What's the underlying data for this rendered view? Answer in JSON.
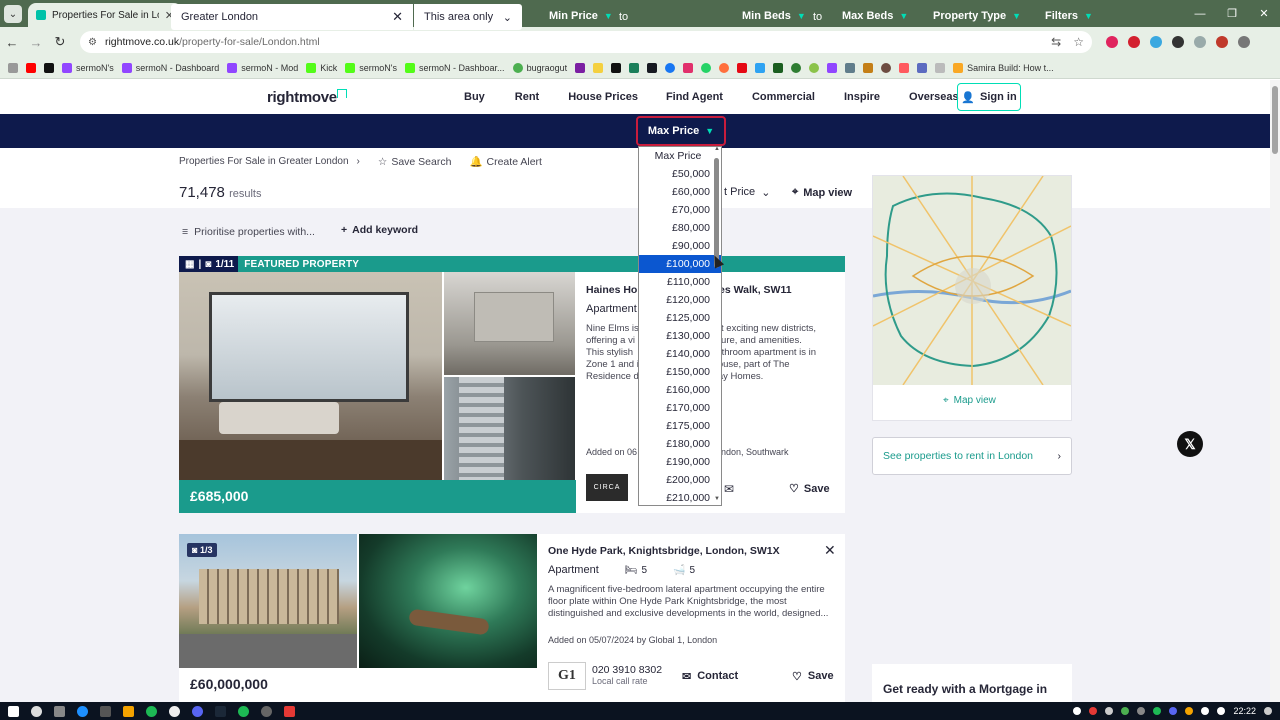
{
  "browser": {
    "tab_title": "Properties For Sale in London",
    "url_host": "rightmove.co.uk",
    "url_path": "/property-for-sale/London.html",
    "window_controls": [
      "—",
      "❐",
      "✕"
    ],
    "bookmarks": [
      "sermoN's",
      "sermoN - Dashboard",
      "sermoN - Mod",
      "Kick",
      "sermoN's",
      "sermoN - Dashboar...",
      "bugraogut",
      "Samira Build: How t..."
    ]
  },
  "header": {
    "logo": "rightmove",
    "nav": [
      "Buy",
      "Rent",
      "House Prices",
      "Find Agent",
      "Commercial",
      "Inspire",
      "Overseas"
    ],
    "signin": "Sign in"
  },
  "searchbar": {
    "location": "Greater London",
    "radius": "This area only",
    "min_price": "Min Price",
    "to1": "to",
    "max_price": "Max Price",
    "min_beds": "Min Beds",
    "to2": "to",
    "max_beds": "Max Beds",
    "property_type": "Property Type",
    "filters": "Filters"
  },
  "dropdown": {
    "header": "Max Price",
    "options": [
      "£50,000",
      "£60,000",
      "£70,000",
      "£80,000",
      "£90,000",
      "£100,000",
      "£110,000",
      "£120,000",
      "£125,000",
      "£130,000",
      "£140,000",
      "£150,000",
      "£160,000",
      "£170,000",
      "£175,000",
      "£180,000",
      "£190,000",
      "£200,000",
      "£210,000"
    ],
    "selected": "£100,000"
  },
  "breadcrumb": {
    "path": "Properties For Sale in Greater London",
    "save_search": "Save Search",
    "create_alert": "Create Alert"
  },
  "results": {
    "count": "71,478",
    "label": "results",
    "sort_fragment": "t Price",
    "map_view": "Map view",
    "prioritise": "Prioritise properties with...",
    "add_keyword": "Add keyword"
  },
  "listing1": {
    "image_counter": "1/11",
    "badge": "FEATURED PROPERTY",
    "price": "£685,000",
    "title_left": "Haines Hou",
    "title_right": "es Walk, SW11",
    "type": "Apartment",
    "desc_left": [
      "Nine Elms is",
      "offering a vi",
      "This stylish",
      "Zone 1 and i",
      "Residence d"
    ],
    "desc_right": [
      "ost exciting new districts,",
      "ulture, and amenities.",
      "bathroom apartment is in",
      "House, part of The",
      "way Homes."
    ],
    "added_left": "Added on 06",
    "added_right": "ondon, Southwark",
    "agent_logo": "CIRCA",
    "save": "Save"
  },
  "listing2": {
    "image_counter": "1/3",
    "price": "£60,000,000",
    "title": "One Hyde Park, Knightsbridge, London, SW1X",
    "type": "Apartment",
    "beds": "5",
    "baths": "5",
    "description": "A magnificent five-bedroom lateral apartment occupying the entire floor plate within One Hyde Park Knightsbridge, the most distinguished and exclusive developments in the world, designed...",
    "added": "Added on 05/07/2024 by Global 1, London",
    "agent_logo": "G1",
    "phone": "020 3910 8302",
    "phone_note": "Local call rate",
    "contact": "Contact",
    "save": "Save"
  },
  "sidebar": {
    "map_link": "Map view",
    "rent_link": "See properties to rent in London",
    "mortgage": "Get ready with a Mortgage in"
  },
  "taskbar": {
    "time": "22:22"
  },
  "colors": {
    "navy": "#0e1a4c",
    "teal": "#1a9b8c",
    "mint": "#00deb6",
    "selected_option": "#0b57d0",
    "active_outline": "#c81c3c"
  }
}
